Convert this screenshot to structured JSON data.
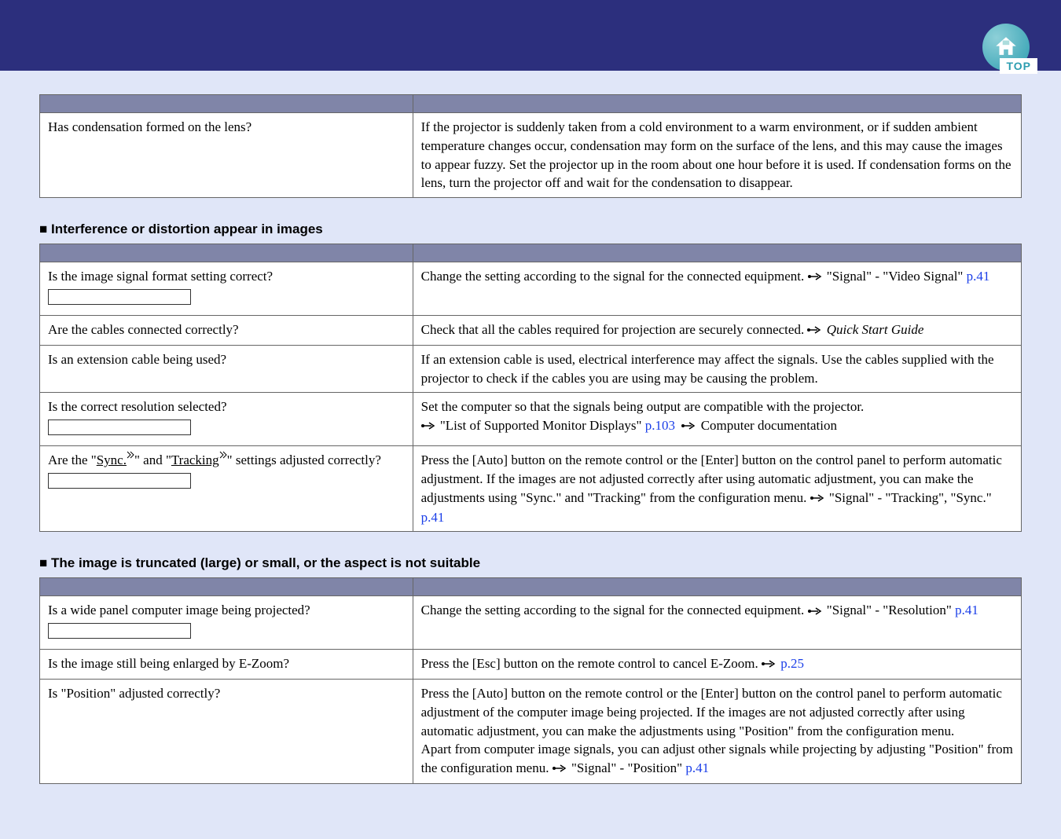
{
  "header": {
    "top_label": "TOP"
  },
  "table1": {
    "rows": [
      {
        "q": "Has condensation formed on the lens?",
        "a": "If the projector is suddenly taken from a cold environment to a warm environment, or if sudden ambient temperature changes occur, condensation may form on the surface of the lens, and this may cause the images to appear fuzzy. Set the projector up in the room about one hour before it is used. If condensation forms on the lens, turn the projector off and wait for the condensation to disappear."
      }
    ]
  },
  "section2": {
    "title": "Interference or distortion appear in images"
  },
  "table2": {
    "r0_q": "Is the image signal format setting correct?",
    "r0_a_pre": "Change the setting according to the signal for the connected equipment. ",
    "r0_a_ref": " \"Signal\" - \"Video Signal\" ",
    "r0_a_page": " p.41",
    "r1_q": "Are the cables connected correctly?",
    "r1_a_pre": "Check that all the cables required for projection are securely connected. ",
    "r1_a_ref": " Quick Start Guide",
    "r2_q": "Is an extension cable being used?",
    "r2_a": "If an extension cable is used, electrical interference may affect the signals. Use the cables supplied with the projector to check if the cables you are using may be causing the problem.",
    "r3_q": "Is the correct resolution selected?",
    "r3_a_line1": "Set the computer so that the signals being output are compatible with the projector.",
    "r3_a_ref1": " \"List of Supported Monitor Displays\" ",
    "r3_a_page1": "p.103",
    "r3_a_ref2": " Computer documentation",
    "r4_q_pre": "Are the \"",
    "r4_q_sync": "Sync.",
    "r4_q_mid": "\" and \"",
    "r4_q_track": "Tracking",
    "r4_q_post": "\" settings adjusted correctly?",
    "r4_a_pre": "Press the [Auto] button on the remote control or the [Enter] button on the control panel to perform automatic adjustment. If the images are not adjusted correctly after using automatic adjustment, you can make the adjustments using \"Sync.\" and \"Tracking\" from the configuration menu. ",
    "r4_a_ref": " \"Signal\" - \"Tracking\", \"Sync.\"",
    "r4_a_page": "p.41"
  },
  "section3": {
    "title": "The image is truncated (large) or small, or the aspect is not suitable"
  },
  "table3": {
    "r0_q": "Is a wide panel computer image being projected?",
    "r0_a_pre": "Change the setting according to the signal for the connected equipment. ",
    "r0_a_ref": " \"Signal\" - \"Resolution\" ",
    "r0_a_page": "p.41",
    "r1_q": "Is the image still being enlarged by E-Zoom?",
    "r1_a_pre": "Press the [Esc] button on the remote control to cancel E-Zoom. ",
    "r1_a_page": " p.25",
    "r2_q": "Is \"Position\" adjusted correctly?",
    "r2_a_pre": "Press the [Auto] button on the remote control or the [Enter] button on the control panel to perform automatic adjustment of the computer image being projected. If the images are not adjusted correctly after using automatic adjustment, you can make the adjustments using \"Position\" from the configuration menu.\nApart from computer image signals, you can adjust other signals while projecting by adjusting \"Position\" from the configuration menu. ",
    "r2_a_ref": " \"Signal\" - \"Position\" ",
    "r2_a_page": "p.41"
  }
}
